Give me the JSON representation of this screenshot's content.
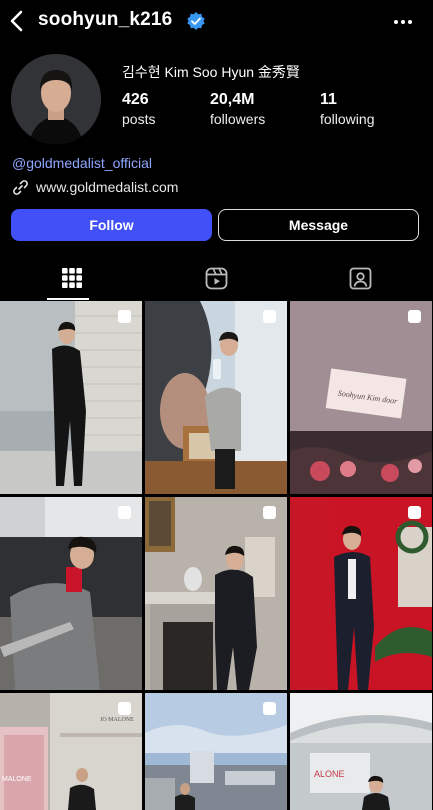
{
  "header": {
    "username": "soohyun_k216",
    "icons": [
      "chevron-left-icon",
      "verified-badge-icon",
      "more-options-icon"
    ]
  },
  "profile": {
    "full_name": "김수현 Kim Soo Hyun 金秀賢",
    "stats": [
      {
        "value": "426",
        "label": "posts"
      },
      {
        "value": "20,4M",
        "label": "followers"
      },
      {
        "value": "11",
        "label": "following"
      }
    ],
    "mention": "@goldmedalist_official",
    "website": "www.goldmedalist.com"
  },
  "actions": {
    "follow_label": "Follow",
    "message_label": "Message"
  },
  "tabs": [
    {
      "name": "grid-icon",
      "active": true
    },
    {
      "name": "reels-icon",
      "active": false
    },
    {
      "name": "tagged-icon",
      "active": false
    }
  ],
  "posts": {
    "grid_photo_captions": [
      "Soohyun Kim door"
    ],
    "store_signs": [
      "MALONE",
      "JO MALONE",
      "ALONE"
    ],
    "colors": {
      "accent": "#4150f7",
      "mention": "#8fa6ff",
      "verified": "#3897f0"
    }
  }
}
